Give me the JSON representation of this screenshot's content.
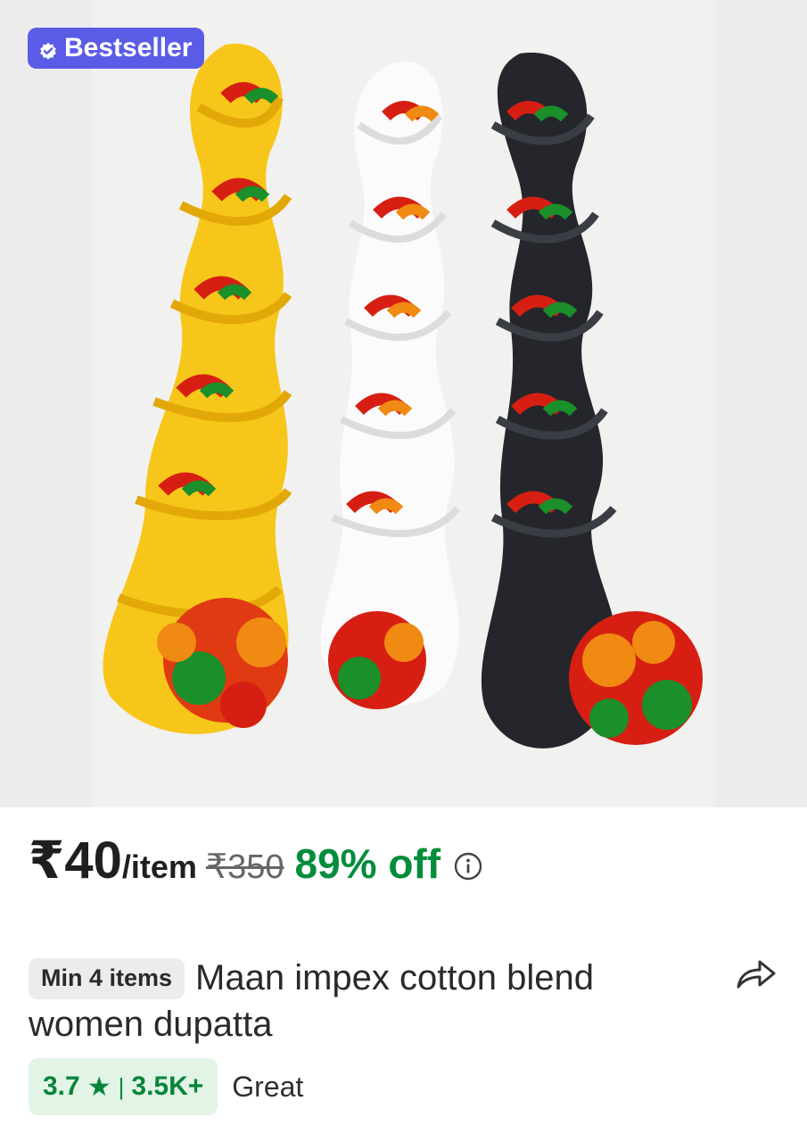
{
  "product": {
    "badge_label": "Bestseller",
    "image_alt": "Three twisted dupattas in yellow, white and black with red, orange and green pom-pom trims",
    "price": {
      "current": "₹40",
      "unit": "/item",
      "original": "₹350",
      "discount": "89% off"
    },
    "min_order_label": "Min 4 items",
    "title": "Maan impex cotton blend women dupatta",
    "rating": {
      "value": "3.7",
      "star": "★",
      "separator": "|",
      "count": "3.5K+",
      "label": "Great"
    }
  },
  "icons": {
    "badge": "verified-check-icon",
    "info": "info-icon",
    "share": "share-icon"
  },
  "colors": {
    "badge_bg": "#5b5ce6",
    "discount": "#038d3b",
    "rating_bg": "#e2f4e6",
    "rating_text": "#07853a"
  }
}
